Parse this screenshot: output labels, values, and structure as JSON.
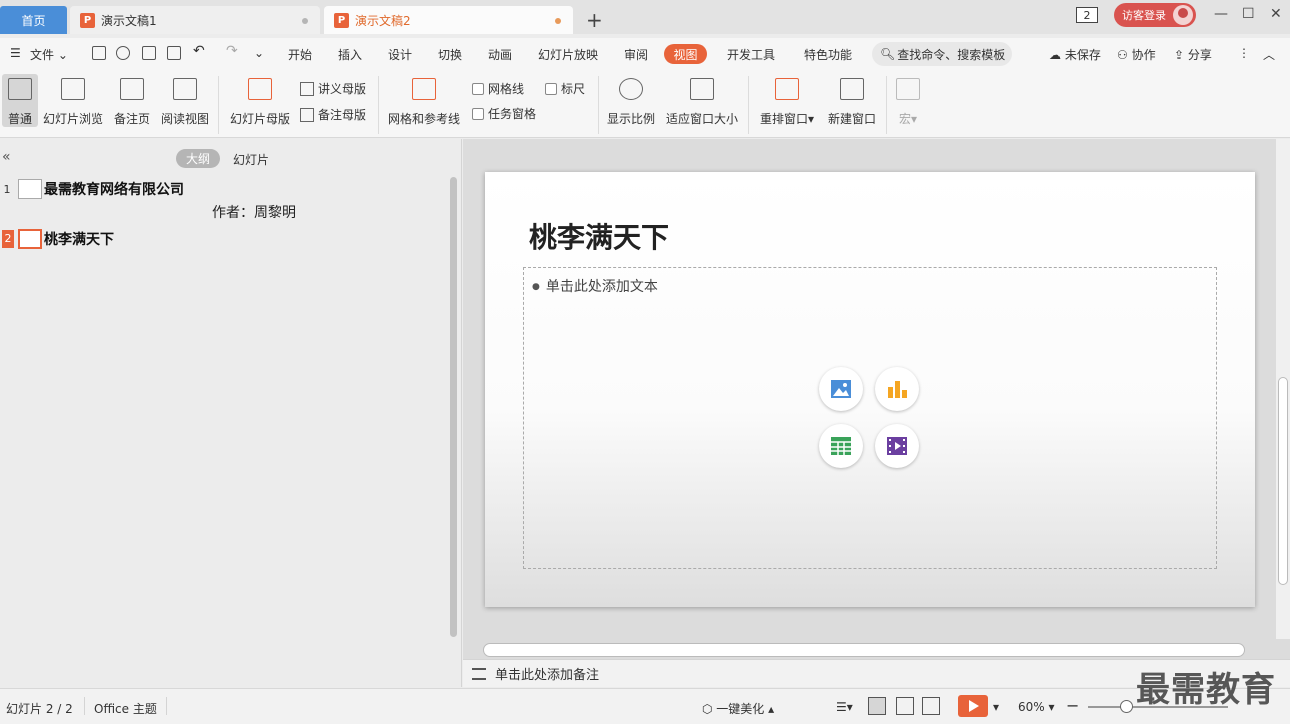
{
  "tabs": {
    "home": "首页",
    "doc1": "演示文稿1",
    "doc2": "演示文稿2",
    "ppt_badge": "P",
    "new_tab": "+"
  },
  "titlebar": {
    "window_count": "2",
    "login": "访客登录",
    "minimize": "—",
    "maximize": "☐",
    "close": "✕"
  },
  "menu": {
    "file": "文件",
    "items": [
      "开始",
      "插入",
      "设计",
      "切换",
      "动画",
      "幻灯片放映",
      "审阅",
      "视图",
      "开发工具",
      "特色功能"
    ],
    "search_placeholder": "查找命令、搜索模板",
    "unsaved": "未保存",
    "collaborate": "协作",
    "share": "分享"
  },
  "ribbon": {
    "normal": "普通",
    "slide_sorter": "幻灯片浏览",
    "notes_page": "备注页",
    "reading_view": "阅读视图",
    "slide_master": "幻灯片母版",
    "handout_master": "讲义母版",
    "notes_master": "备注母版",
    "grid_guides": "网格和参考线",
    "gridlines": "网格线",
    "ruler": "标尺",
    "task_pane": "任务窗格",
    "zoom": "显示比例",
    "fit_window": "适应窗口大小",
    "arrange": "重排窗口",
    "new_window": "新建窗口",
    "macro": "宏"
  },
  "leftpane": {
    "outline_tab": "大纲",
    "slides_tab": "幻灯片",
    "items": [
      {
        "num": "1",
        "title": "最需教育网络有限公司",
        "subtitle": "作者：周黎明"
      },
      {
        "num": "2",
        "title": "桃李满天下"
      }
    ]
  },
  "slide": {
    "title": "桃李满天下",
    "placeholder": "单击此处添加文本"
  },
  "notes": {
    "placeholder": "单击此处添加备注"
  },
  "status": {
    "slide_count": "幻灯片 2 / 2",
    "theme": "Office 主题",
    "beautify": "一键美化",
    "zoom": "60%"
  },
  "watermark": "最需教育",
  "colors": {
    "accent": "#e8633a",
    "home_tab": "#4a8ed8",
    "login": "#d9534f"
  }
}
